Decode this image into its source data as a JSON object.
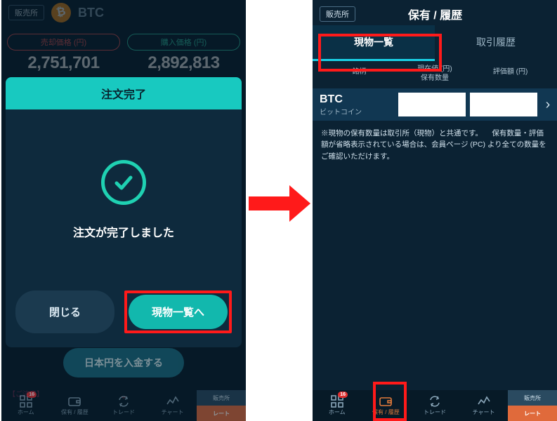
{
  "left": {
    "dealer_chip": "販売所",
    "symbol": "BTC",
    "sell": {
      "label": "売却価格 (円)",
      "value": "2,751,701"
    },
    "buy": {
      "label": "購入価格 (円)",
      "value": "2,892,813"
    },
    "modal": {
      "title": "注文完了",
      "message": "注文が完了しました",
      "close_label": "閉じる",
      "list_label": "現物一覧へ"
    },
    "deposit_label": "日本円を入金する",
    "notice_label": "【ご注意】",
    "nav": {
      "home": "ホーム",
      "hold": "保有 / 履歴",
      "trade": "トレード",
      "chart": "チャート",
      "dealer": "販売所",
      "rate": "レート",
      "badge": "16"
    }
  },
  "right": {
    "dealer_chip": "販売所",
    "title": "保有 / 履歴",
    "tabs": {
      "list": "現物一覧",
      "history": "取引履歴"
    },
    "cols": {
      "name": "銘柄",
      "cur1": "現在値 (円)",
      "cur2": "保有数量",
      "val": "評価額 (円)"
    },
    "row": {
      "ticker": "BTC",
      "name_jp": "ビットコイン"
    },
    "footnote": "※現物の保有数量は取引所（現物）と共通です。\n　保有数量・評価額が省略表示されている場合は、会員ページ (PC) より全ての数量をご確認いただけます。",
    "nav": {
      "home": "ホーム",
      "hold": "保有 / 履歴",
      "trade": "トレード",
      "chart": "チャート",
      "dealer": "販売所",
      "rate": "レート",
      "badge": "16"
    }
  }
}
